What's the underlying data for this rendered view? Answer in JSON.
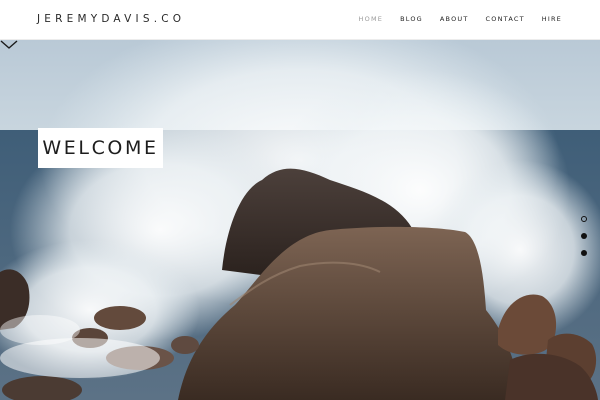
{
  "site": {
    "logo": "JEREMYDAVIS.CO"
  },
  "nav": {
    "items": [
      {
        "label": "HOME",
        "active": true
      },
      {
        "label": "BLOG",
        "active": false
      },
      {
        "label": "ABOUT",
        "active": false
      },
      {
        "label": "CONTACT",
        "active": false
      },
      {
        "label": "HIRE",
        "active": false
      }
    ]
  },
  "hero": {
    "heading": "WELCOME",
    "slides": 3,
    "active_slide": 1,
    "scroll_icon": "chevron-down-icon",
    "image": "ocean-wave-on-rocks"
  },
  "colors": {
    "header_bg": "#ffffff",
    "nav_active": "#9a9a9a",
    "text": "#222222"
  }
}
